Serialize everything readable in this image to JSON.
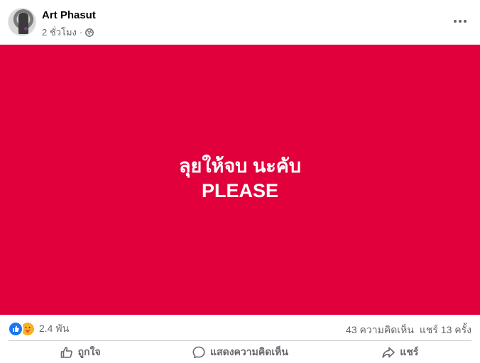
{
  "post": {
    "author": "Art Phasut",
    "time": "2 ชั่วโมง",
    "separator": "·",
    "privacy_icon": "globe-icon",
    "more_icon": "more-options-icon"
  },
  "media": {
    "background_color": "#e1003b",
    "line1": "ลุยให้จบ นะคับ",
    "line2": "PLEASE"
  },
  "stats": {
    "reactions": [
      "like",
      "care"
    ],
    "reaction_count": "2.4 พัน",
    "comments": "43 ความคิดเห็น",
    "shares": "แชร์ 13 ครั้ง"
  },
  "actions": {
    "like_label": "ถูกใจ",
    "comment_label": "แสดงความคิดเห็น",
    "share_label": "แชร์"
  }
}
